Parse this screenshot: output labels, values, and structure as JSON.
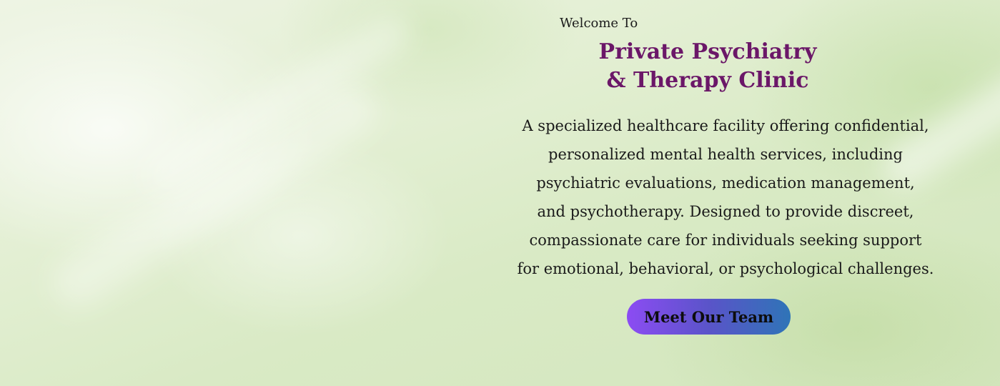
{
  "hero": {
    "welcome": "Welcome To",
    "title_lines": [
      "Private Psychiatry",
      "& Therapy Clinic"
    ],
    "description_lines": [
      "A specialized healthcare facility offering confidential,",
      "personalized mental health services, including",
      "psychiatric evaluations, medication management,",
      "and psychotherapy. Designed to provide discreet,",
      "compassionate care for individuals seeking support",
      "for emotional, behavioral, or psychological challenges."
    ],
    "cta_label": "Meet Our Team"
  },
  "colors": {
    "title": "#6b1768",
    "cta_gradient_start": "#8c4cf3",
    "cta_gradient_end": "#2f74b7",
    "background": "#e3efd3"
  }
}
